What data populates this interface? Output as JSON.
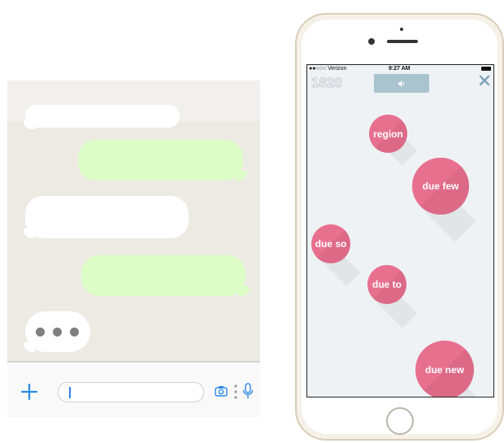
{
  "chat": {
    "composer": {
      "input_value": "",
      "icons": [
        "plus-icon",
        "camera-icon",
        "more-icon",
        "microphone-icon"
      ]
    },
    "typing_indicator": "•••",
    "colors": {
      "incoming": "#ffffff",
      "outgoing": "#dcfdc6",
      "background": "#edeae4"
    }
  },
  "game": {
    "status_bar": {
      "carrier": "●●○○○ Verizon",
      "time": "9:27 AM"
    },
    "score": "1820",
    "sound_icon": "speaker-icon",
    "close_icon": "close-icon",
    "words": [
      "region",
      "due few",
      "due so",
      "due to",
      "due new"
    ],
    "colors": {
      "bubble": "#e8708f",
      "screen": "#eef2f5",
      "sound_button": "#a9c3cf"
    }
  }
}
